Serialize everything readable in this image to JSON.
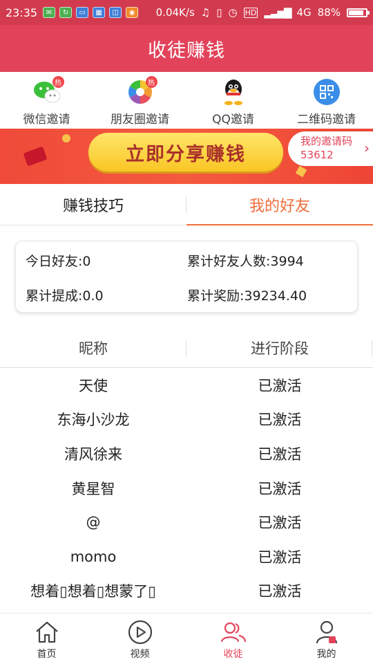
{
  "status_bar": {
    "time": "23:35",
    "network_speed": "0.04K/s",
    "network_type": "4G",
    "battery": "88%",
    "battery_level": 0.88
  },
  "header": {
    "title": "收徒赚钱"
  },
  "invite_options": [
    {
      "label": "微信邀请",
      "icon": "wechat-icon",
      "hot": true,
      "hot_text": "热"
    },
    {
      "label": "朋友圈邀请",
      "icon": "moments-icon",
      "hot": true,
      "hot_text": "热"
    },
    {
      "label": "QQ邀请",
      "icon": "qq-icon",
      "hot": false
    },
    {
      "label": "二维码邀请",
      "icon": "qrcode-icon",
      "hot": false
    }
  ],
  "banner": {
    "share_button": "立即分享赚钱",
    "invite_code_label": "我的邀请码",
    "invite_code": "53612"
  },
  "tabs": [
    {
      "label": "赚钱技巧",
      "active": false
    },
    {
      "label": "我的好友",
      "active": true
    }
  ],
  "stats": {
    "today_friends_label": "今日好友:",
    "today_friends": "0",
    "total_friends_label": "累计好友人数:",
    "total_friends": "3994",
    "total_commission_label": "累计提成:",
    "total_commission": "0.0",
    "total_reward_label": "累计奖励:",
    "total_reward": "39234.40"
  },
  "friends_table": {
    "columns": [
      "昵称",
      "进行阶段"
    ],
    "rows": [
      {
        "nickname": "天使",
        "stage": "已激活"
      },
      {
        "nickname": "东海小沙龙",
        "stage": "已激活"
      },
      {
        "nickname": "清风徐来",
        "stage": "已激活"
      },
      {
        "nickname": "黄星智",
        "stage": "已激活"
      },
      {
        "nickname": "@",
        "stage": "已激活"
      },
      {
        "nickname": "momo",
        "stage": "已激活"
      },
      {
        "nickname": "想着▯想着▯想蒙了▯",
        "stage": "已激活"
      }
    ]
  },
  "bottom_nav": [
    {
      "label": "首页",
      "icon": "home-icon",
      "active": false
    },
    {
      "label": "视频",
      "icon": "video-play-icon",
      "active": false
    },
    {
      "label": "收徒",
      "icon": "users-icon",
      "active": true
    },
    {
      "label": "我的",
      "icon": "profile-icon",
      "active": false
    }
  ],
  "colors": {
    "brand_red": "#e2435a",
    "tab_active": "#f06c3b",
    "button_yellow": "#f9c624"
  }
}
